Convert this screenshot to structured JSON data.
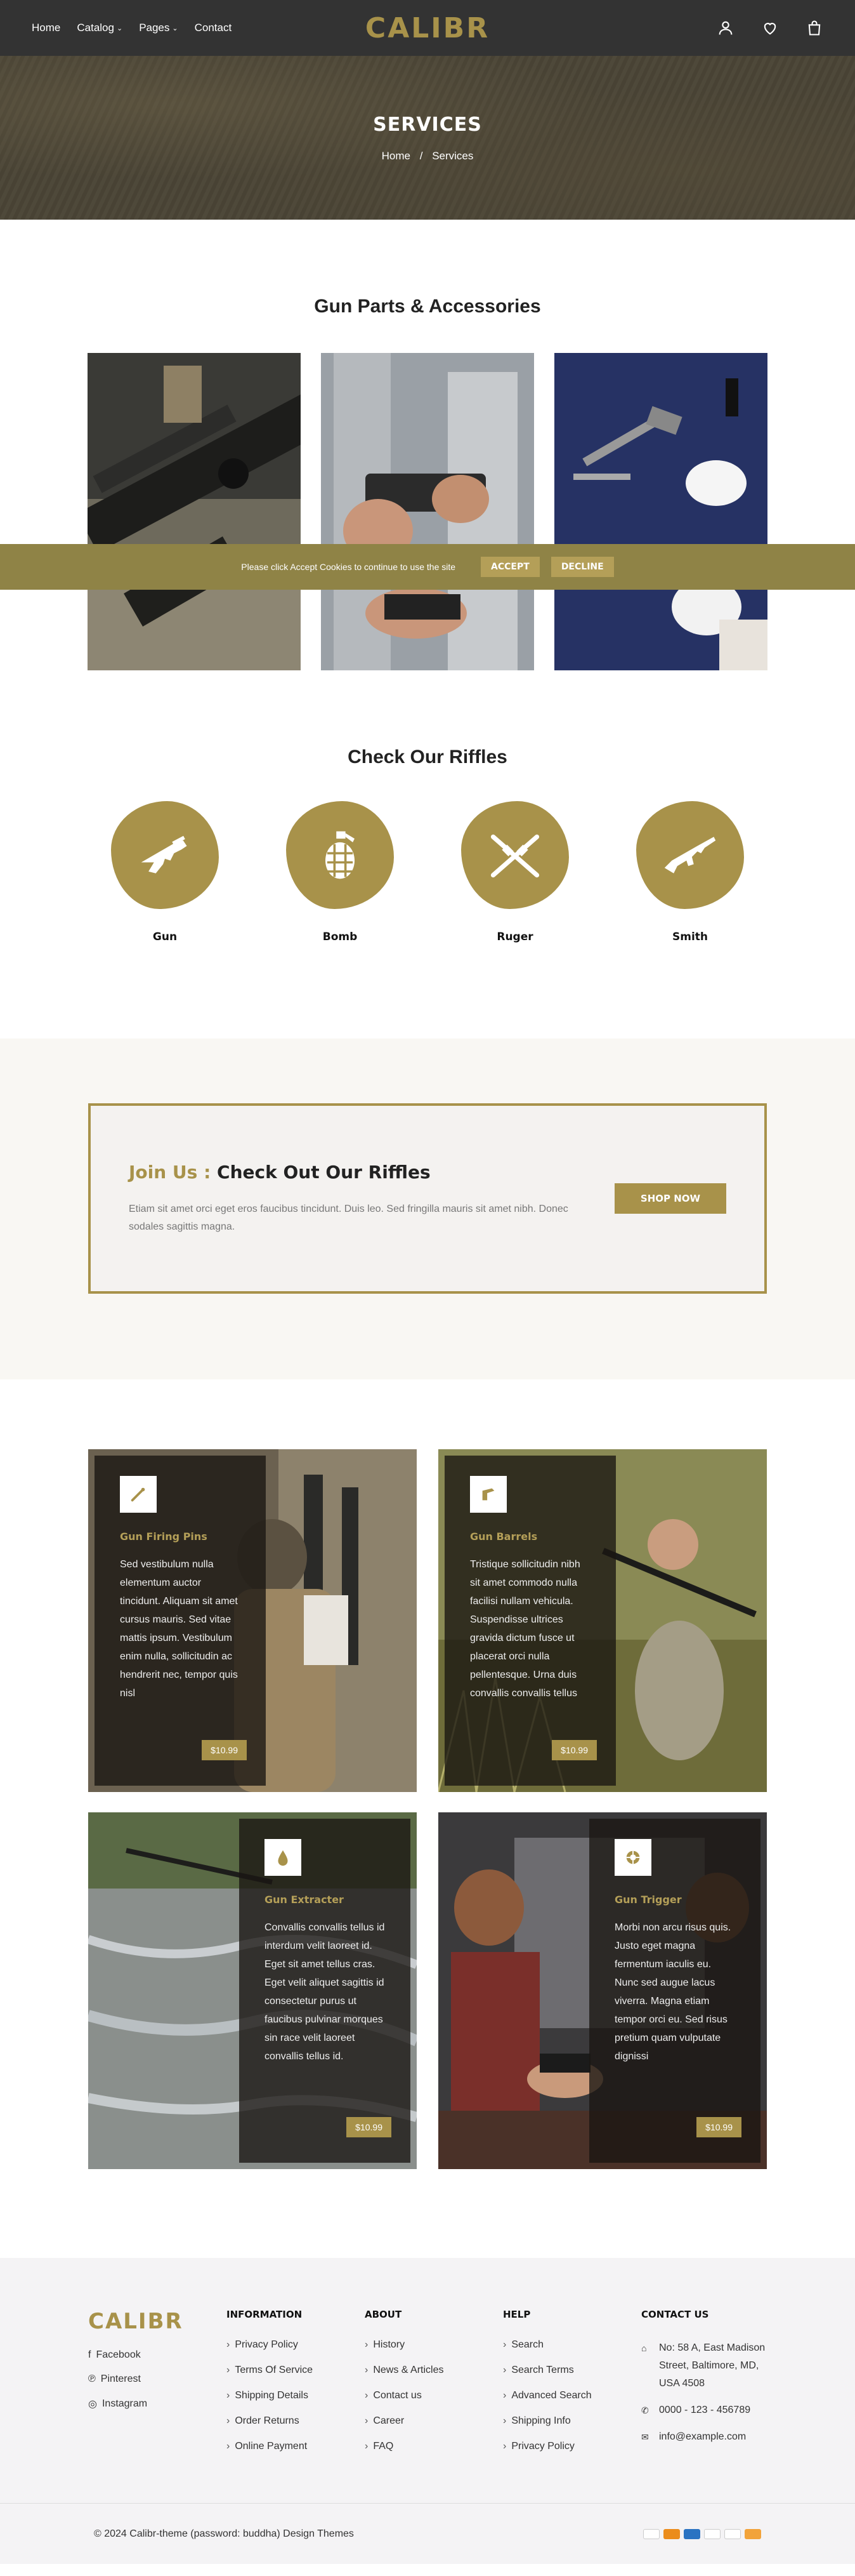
{
  "header": {
    "nav": [
      {
        "label": "Home",
        "dropdown": false
      },
      {
        "label": "Catalog",
        "dropdown": true
      },
      {
        "label": "Pages",
        "dropdown": true
      },
      {
        "label": "Contact",
        "dropdown": false
      }
    ],
    "logo": "CALIBR",
    "icons": [
      "account-icon",
      "wishlist-icon",
      "cart-icon"
    ]
  },
  "banner": {
    "title": "SERVICES",
    "breadcrumb": [
      "Home",
      "Services"
    ],
    "separator": "/"
  },
  "parts": {
    "title": "Gun Parts & Accessories"
  },
  "cookie": {
    "message": "Please click Accept Cookies to continue to use the site",
    "accept": "ACCEPT",
    "decline": "DECLINE"
  },
  "riffles": {
    "title": "Check Our Riffles",
    "items": [
      "Gun",
      "Bomb",
      "Ruger",
      "Smith"
    ]
  },
  "join": {
    "accent": "Join Us :",
    "heading": "Check Out Our Riffles",
    "description": "Etiam sit amet orci eget eros faucibus tincidunt. Duis leo. Sed fringilla mauris sit amet nibh. Donec sodales sagittis magna.",
    "button": "SHOP NOW"
  },
  "features": [
    {
      "title": "Gun Firing Pins",
      "description": "Sed vestibulum nulla elementum auctor tincidunt. Aliquam sit amet cursus mauris. Sed vitae mattis ipsum. Vestibulum enim nulla, sollicitudin ac hendrerit nec, tempor quis nisl",
      "price": "$10.99"
    },
    {
      "title": "Gun Barrels",
      "description": "Tristique sollicitudin nibh sit amet commodo nulla facilisi nullam vehicula. Suspendisse ultrices gravida dictum fusce ut placerat orci nulla pellentesque. Urna duis convallis convallis tellus",
      "price": "$10.99"
    },
    {
      "title": "Gun Extracter",
      "description": "Convallis convallis tellus id interdum velit laoreet id. Eget sit amet tellus cras. Eget velit aliquet sagittis id consectetur purus ut faucibus pulvinar morques sin race velit laoreet convallis tellus id.",
      "price": "$10.99"
    },
    {
      "title": "Gun Trigger",
      "description": "Morbi non arcu risus quis. Justo eget magna fermentum iaculis eu. Nunc sed augue lacus viverra. Magna etiam tempor orci eu. Sed risus pretium quam vulputate dignissi",
      "price": "$10.99"
    }
  ],
  "footer": {
    "logo": "CALIBR",
    "social": [
      "Facebook",
      "Pinterest",
      "Instagram"
    ],
    "information": {
      "title": "INFORMATION",
      "links": [
        "Privacy Policy",
        "Terms Of Service",
        "Shipping Details",
        "Order Returns",
        "Online Payment"
      ]
    },
    "about": {
      "title": "ABOUT",
      "links": [
        "History",
        "News & Articles",
        "Contact us",
        "Career",
        "FAQ"
      ]
    },
    "help": {
      "title": "HELP",
      "links": [
        "Search",
        "Search Terms",
        "Advanced Search",
        "Shipping Info",
        "Privacy Policy"
      ]
    },
    "contact": {
      "title": "CONTACT US",
      "address": "No: 58 A, East Madison Street, Baltimore, MD, USA 4508",
      "phone": "0000 - 123 - 456789",
      "email": "info@example.com"
    },
    "copyright": "© 2024 Calibr-theme (password: buddha) Design Themes",
    "payments": [
      "visa",
      "mastercard",
      "amex",
      "paypal",
      "diners",
      "discover"
    ]
  },
  "colors": {
    "accent": "#a8924a",
    "header_bg": "#333333",
    "cookie_bg": "#8f8346"
  }
}
